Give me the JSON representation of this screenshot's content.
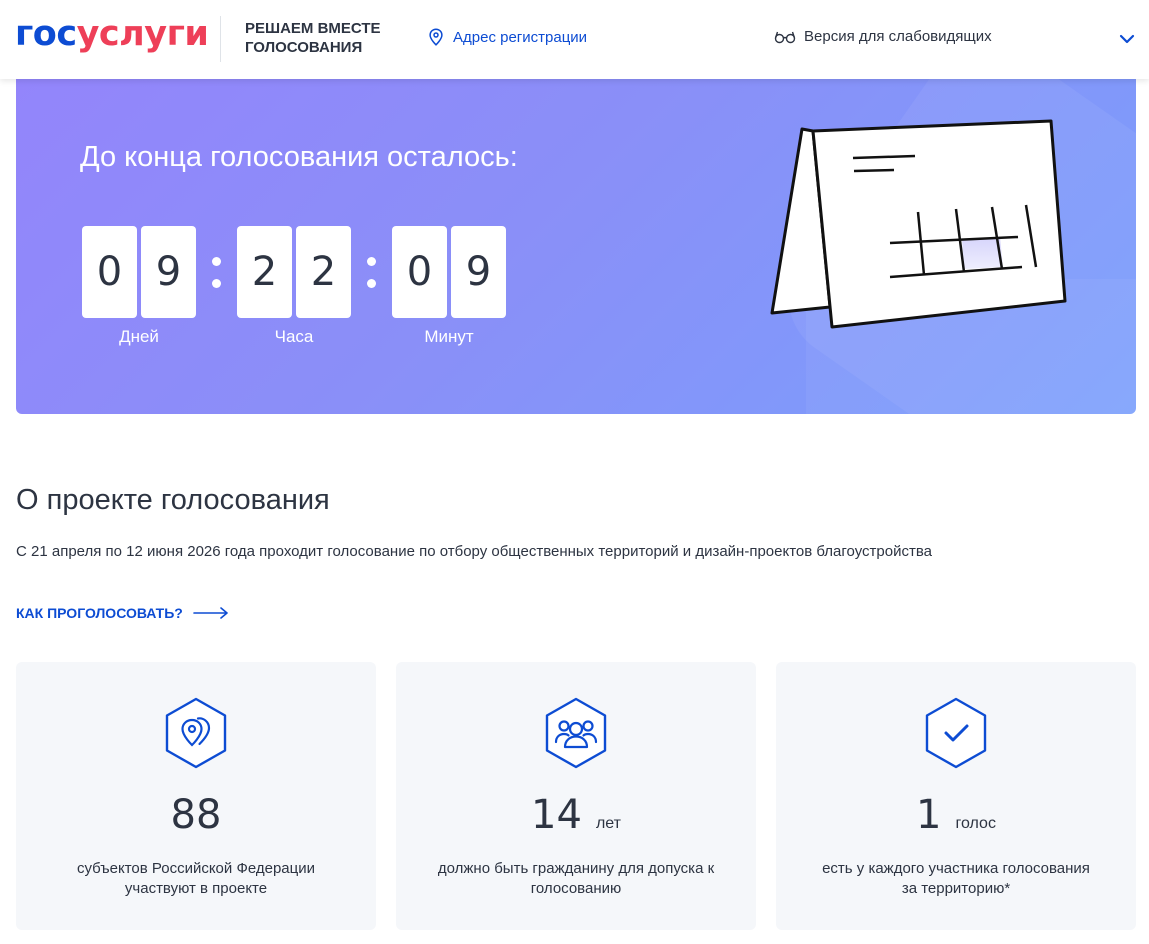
{
  "header": {
    "logo_part1": "гос",
    "logo_part2": "услуги",
    "slogan": "РЕШАЕМ ВМЕСТЕ ГОЛОСОВАНИЯ",
    "address_label": "Адрес регистрации",
    "vision_label": "Версия для слабовидящих"
  },
  "banner": {
    "title": "До конца голосования осталось:",
    "days": [
      "0",
      "9"
    ],
    "days_label": "Дней",
    "hours": [
      "2",
      "2"
    ],
    "hours_label": "Часа",
    "minutes": [
      "0",
      "9"
    ],
    "minutes_label": "Минут"
  },
  "about": {
    "title": "О проекте голосования",
    "text": "С 21 апреля по 12 июня 2026 года проходит голосование по отбору общественных территорий и дизайн-проектов благоустройства",
    "how_link": "КАК ПРОГОЛОСОВАТЬ?"
  },
  "cards": [
    {
      "icon": "map-pin-icon",
      "number": "88",
      "unit": "",
      "desc": "субъектов Российской Федерации участвуют в проекте"
    },
    {
      "icon": "people-icon",
      "number": "14",
      "unit": "лет",
      "desc": "должно быть гражданину для допуска к голосованию"
    },
    {
      "icon": "checkmark-icon",
      "number": "1",
      "unit": "голос",
      "desc": "есть у каждого участника голосования за территорию*"
    }
  ],
  "colors": {
    "brand_blue": "#0d4cd3",
    "brand_red": "#ee3f58",
    "banner_start": "#9385fb",
    "banner_end": "#7a9ffc",
    "text": "#2d3442",
    "card_bg": "#f5f7fa"
  }
}
